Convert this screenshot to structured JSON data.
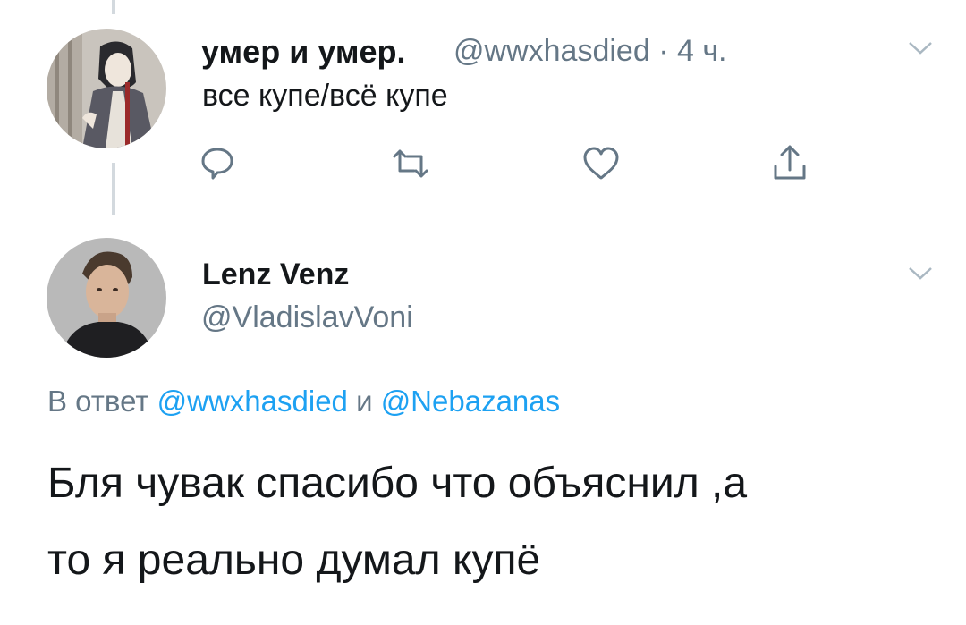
{
  "tweet1": {
    "author_name": "умер и умер.",
    "handle": "@wwxhasdied",
    "separator": "·",
    "time": "4 ч.",
    "text": "все купе/всё купе",
    "avatar": "anime-character-avatar"
  },
  "tweet2": {
    "author_name": "Lenz Venz",
    "handle": "@VladislavVoni",
    "avatar": "man-portrait-avatar",
    "reply_prefix": "В ответ",
    "reply_mention_1": "@wwxhasdied",
    "reply_connector": "и",
    "reply_mention_2": "@Nebazanas",
    "text_line1": "Бля чувак спасибо что объяснил ,а",
    "text_line2": "то я реально думал купё"
  },
  "icons": [
    "reply-icon",
    "retweet-icon",
    "like-icon",
    "share-icon",
    "chevron-down-icon"
  ],
  "colors": {
    "text": "#14171a",
    "secondary": "#657786",
    "link": "#1da1f2",
    "icon": "#657786",
    "thread_line": "#d3d9de"
  }
}
